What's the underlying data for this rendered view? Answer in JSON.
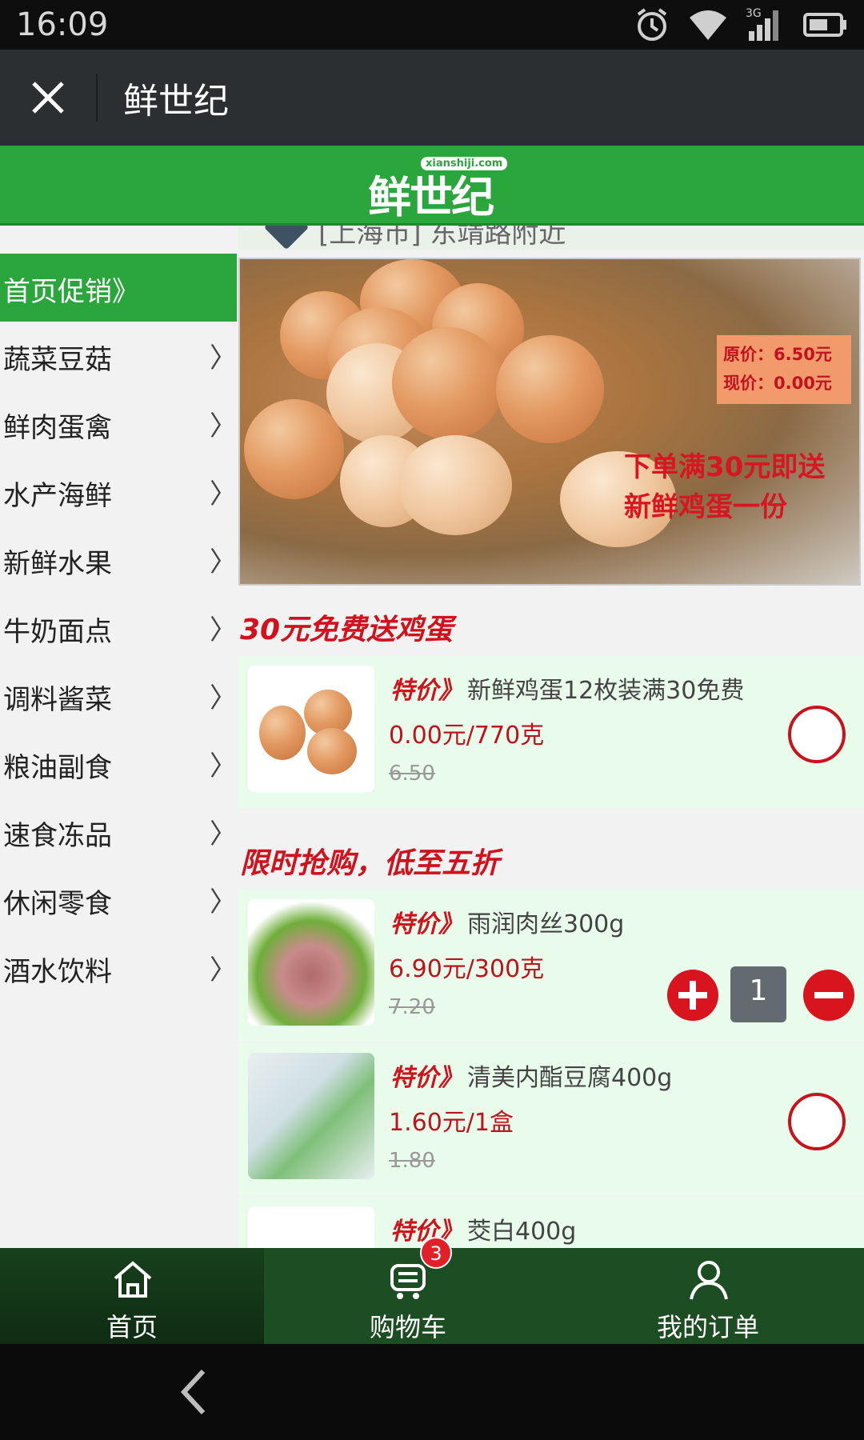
{
  "status_bar": {
    "time": "16:09",
    "icons": [
      "alarm-icon",
      "wifi-icon",
      "signal-3g-icon",
      "battery-icon"
    ],
    "network_label": "3G"
  },
  "title_bar": {
    "title": "鲜世纪",
    "close_icon": "close-icon"
  },
  "header": {
    "logo_text": "鲜世纪",
    "logo_url_text": "xianshiji.com"
  },
  "location": {
    "text": "[上海市] 东靖路附近",
    "icon": "location-pin-icon"
  },
  "sidebar": {
    "items": [
      {
        "label": "首页促销》",
        "active": true
      },
      {
        "label": "蔬菜豆菇",
        "chevron": "〉"
      },
      {
        "label": "鲜肉蛋禽",
        "chevron": "〉"
      },
      {
        "label": "水产海鲜",
        "chevron": "〉"
      },
      {
        "label": "新鲜水果",
        "chevron": "〉"
      },
      {
        "label": "牛奶面点",
        "chevron": "〉"
      },
      {
        "label": "调料酱菜",
        "chevron": "〉"
      },
      {
        "label": "粮油副食",
        "chevron": "〉"
      },
      {
        "label": "速食冻品",
        "chevron": "〉"
      },
      {
        "label": "休闲零食",
        "chevron": "〉"
      },
      {
        "label": "酒水饮料",
        "chevron": "〉"
      }
    ]
  },
  "banner": {
    "orig_price": "原价：6.50元",
    "now_price": "现价：0.00元",
    "promo_line1": "下单满30元即送",
    "promo_line2": "新鲜鸡蛋一份"
  },
  "sections": [
    {
      "title": "30元免费送鸡蛋"
    },
    {
      "title": "限时抢购，低至五折"
    }
  ],
  "products": [
    {
      "tag": "特价》",
      "name": "新鲜鸡蛋12枚装满30免费",
      "price": "0.00元/770克",
      "orig": "6.50",
      "in_cart": false
    },
    {
      "tag": "特价》",
      "name": "雨润肉丝300g",
      "price": "6.90元/300克",
      "orig": "7.20",
      "in_cart": true,
      "quantity": "1"
    },
    {
      "tag": "特价》",
      "name": "清美内酯豆腐400g",
      "price": "1.60元/1盒",
      "orig": "1.80",
      "in_cart": false
    },
    {
      "tag": "特价》",
      "name": "茭白400g"
    }
  ],
  "bottom_nav": {
    "tabs": [
      {
        "label": "首页",
        "icon": "home-icon",
        "active": true
      },
      {
        "label": "购物车",
        "icon": "cart-icon",
        "badge": "3"
      },
      {
        "label": "我的订单",
        "icon": "user-icon"
      }
    ]
  },
  "colors": {
    "brand_green": "#2aa63c",
    "dark_green": "#1d4d22",
    "accent_red": "#d0121c",
    "product_bg": "#e9fbea"
  }
}
